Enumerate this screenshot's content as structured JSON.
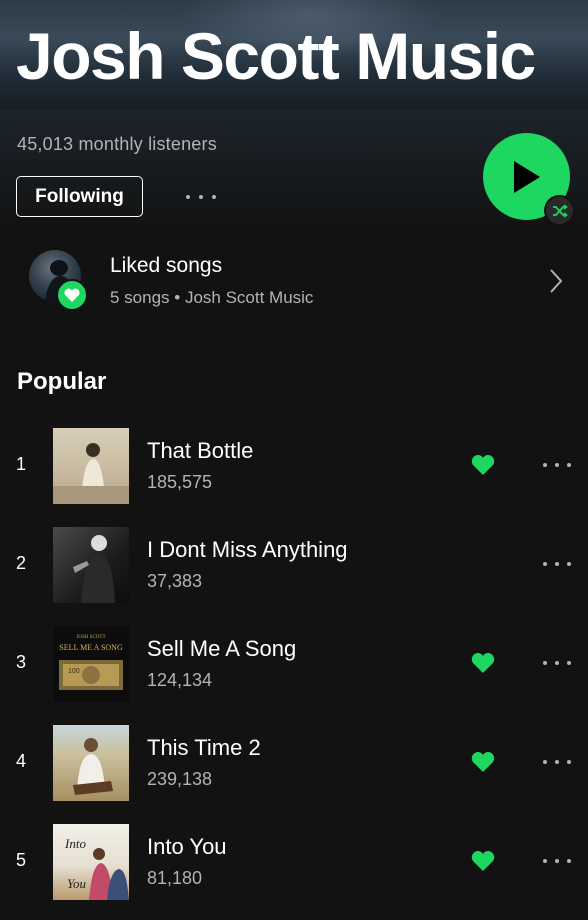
{
  "artist": {
    "name": "Josh Scott Music",
    "monthly_listeners": "45,013 monthly listeners",
    "follow_label": "Following"
  },
  "liked": {
    "title": "Liked songs",
    "subtitle": "5 songs • Josh Scott Music"
  },
  "popular": {
    "heading": "Popular",
    "tracks": [
      {
        "rank": "1",
        "title": "That Bottle",
        "plays": "185,575",
        "liked": true,
        "art_text": ""
      },
      {
        "rank": "2",
        "title": "I Dont Miss Anything",
        "plays": "37,383",
        "liked": false,
        "art_text": ""
      },
      {
        "rank": "3",
        "title": "Sell Me A Song",
        "plays": "124,134",
        "liked": true,
        "art_text": "JOSH SCOTT"
      },
      {
        "rank": "4",
        "title": "This Time 2",
        "plays": "239,138",
        "liked": true,
        "art_text": ""
      },
      {
        "rank": "5",
        "title": "Into You",
        "plays": "81,180",
        "liked": true,
        "art_text": ""
      }
    ]
  },
  "colors": {
    "accent": "#1ed760",
    "background": "#121212",
    "secondary_text": "#b3b3b3"
  },
  "icons": {
    "play": "play-icon",
    "shuffle": "shuffle-icon",
    "heart": "heart-icon",
    "chevron": "chevron-right-icon",
    "more": "more-horizontal-icon"
  }
}
